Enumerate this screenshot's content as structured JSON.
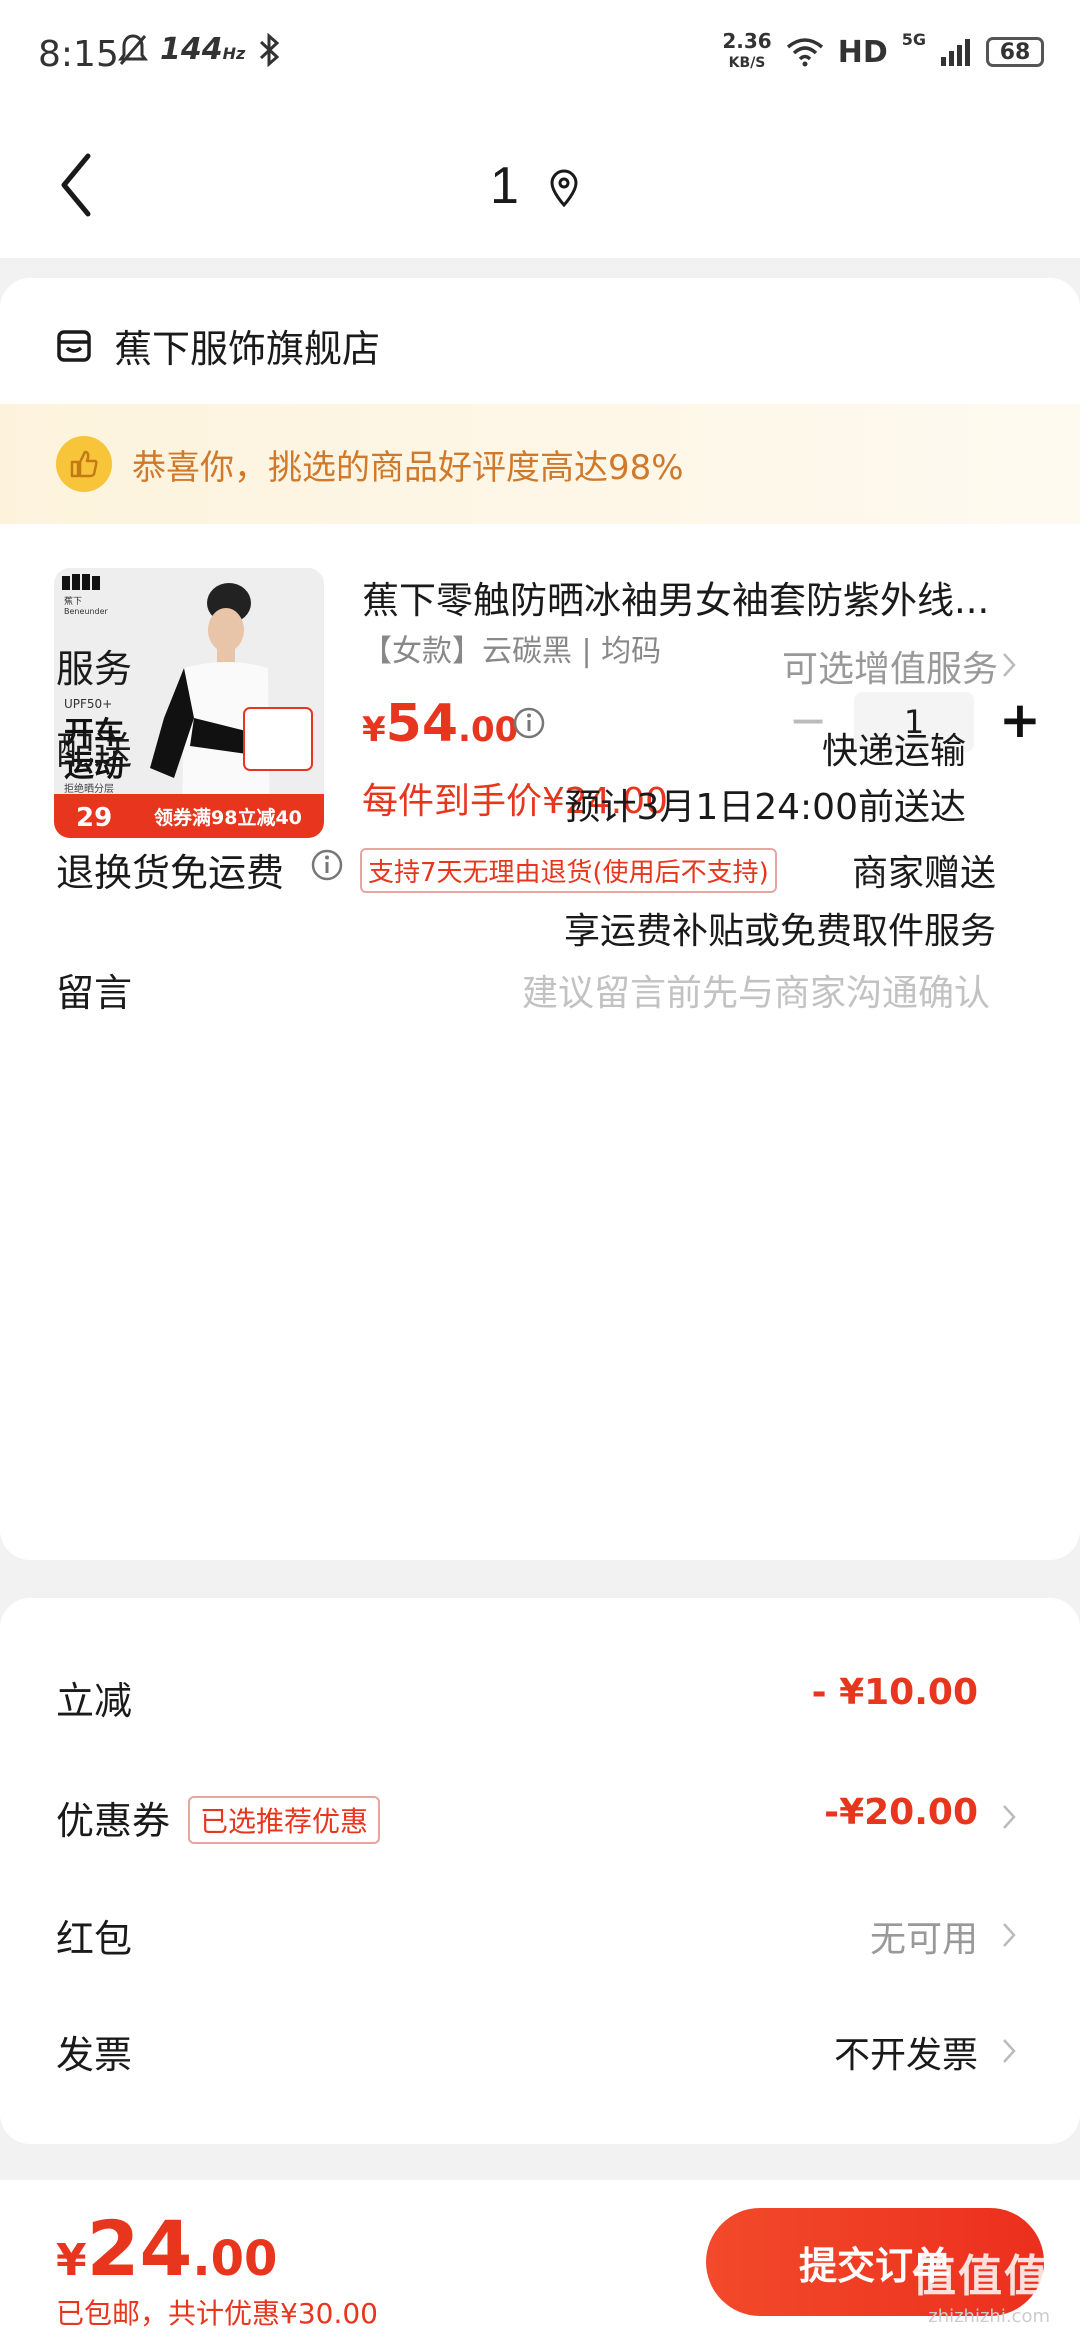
{
  "status_bar": {
    "time": "8:15",
    "refresh_rate": "144",
    "refresh_unit": "Hz",
    "net_speed_value": "2.36",
    "net_speed_unit": "KB/S",
    "hd": "HD",
    "network": "5G",
    "battery": "68"
  },
  "nav": {
    "title": "1"
  },
  "shop": {
    "name": "蕉下服饰旗舰店"
  },
  "banner": {
    "text": "恭喜你，挑选的商品好评度高达98%"
  },
  "product": {
    "title": "蕉下零触防晒冰袖男女袖套防紫外线...",
    "spec": "【女款】云碳黑 | 均码",
    "price_currency": "¥",
    "price_int": "54",
    "price_dec": ".00",
    "quantity": "1",
    "final_price": "每件到手价¥24.00",
    "return_policy": "支持7天无理由退货(使用后不支持)",
    "image_texts": {
      "brand": "蕉下",
      "brand_en": "Beneunder",
      "upf": "UPF50+",
      "line1": "开车",
      "line2": "运动",
      "sub": "拒绝晒分层",
      "promo_price": "29",
      "promo_coupon": "领券满98立减40"
    }
  },
  "rows": {
    "service": {
      "label": "服务",
      "value": "可选增值服务"
    },
    "delivery": {
      "label": "配送",
      "value": "快递运输",
      "eta": "预计3月1日24:00前送达"
    },
    "return_shipping": {
      "label": "退换货免运费",
      "value": "商家赠送",
      "sub": "享运费补贴或免费取件服务"
    },
    "message": {
      "label": "留言",
      "placeholder": "建议留言前先与商家沟通确认"
    }
  },
  "discounts": {
    "instant": {
      "label": "立减",
      "value": "- ¥10.00"
    },
    "coupon": {
      "label": "优惠券",
      "tag": "已选推荐优惠",
      "value": "-¥20.00"
    },
    "red_packet": {
      "label": "红包",
      "value": "无可用"
    },
    "invoice": {
      "label": "发票",
      "value": "不开发票"
    }
  },
  "bottom": {
    "currency": "¥",
    "total_int": "24",
    "total_dec": ".00",
    "note": "已包邮，共计优惠¥30.00",
    "submit": "提交订单",
    "watermark": "值值值",
    "watermark_sub": "zhizhizhi.com"
  },
  "colors": {
    "accent": "#e8361e",
    "banner_text": "#d0792a",
    "background": "#f2f2f2"
  }
}
